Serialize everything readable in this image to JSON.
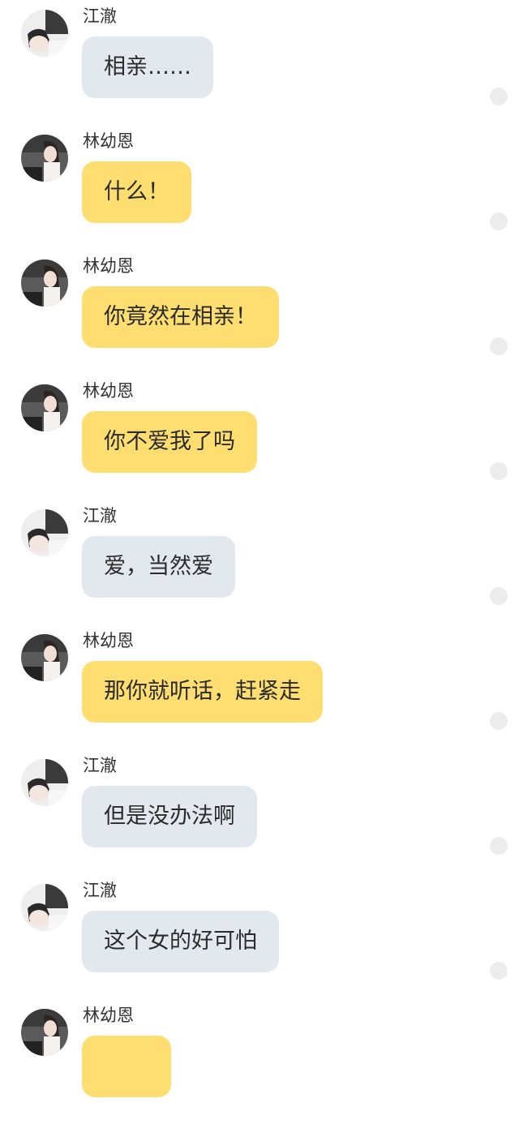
{
  "speakers": {
    "jiang": {
      "name": "江澈",
      "bubble_color": "#e3e8ef",
      "avatar": "avatar-jiang"
    },
    "lin": {
      "name": "林幼恩",
      "bubble_color": "#ffde71",
      "avatar": "avatar-lin"
    }
  },
  "messages": [
    {
      "sender": "江澈",
      "text": "相亲……"
    },
    {
      "sender": "林幼恩",
      "text": "什么！"
    },
    {
      "sender": "林幼恩",
      "text": "你竟然在相亲！"
    },
    {
      "sender": "林幼恩",
      "text": "你不爱我了吗"
    },
    {
      "sender": "江澈",
      "text": "爱，当然爱"
    },
    {
      "sender": "林幼恩",
      "text": "那你就听话，赶紧走"
    },
    {
      "sender": "江澈",
      "text": "但是没办法啊"
    },
    {
      "sender": "江澈",
      "text": "这个女的好可怕"
    },
    {
      "sender": "林幼恩",
      "text": ""
    }
  ]
}
